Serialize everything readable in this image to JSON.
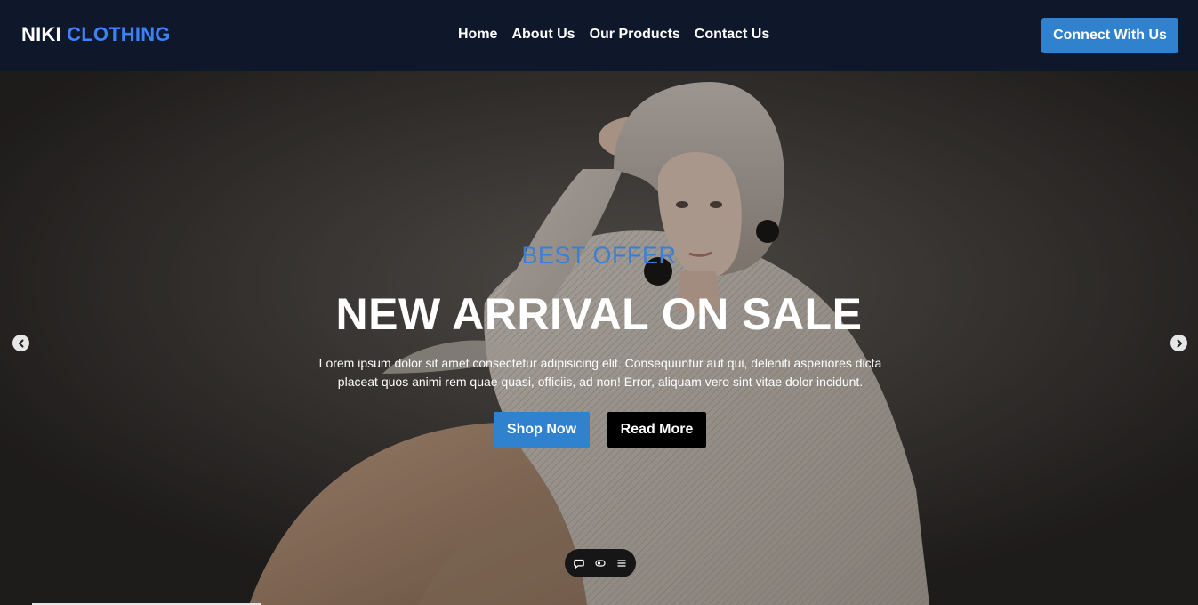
{
  "header": {
    "brand_part1": "NIKI",
    "brand_part2": "CLOTHING",
    "nav": [
      "Home",
      "About Us",
      "Our Products",
      "Contact Us"
    ],
    "cta": "Connect With Us"
  },
  "hero": {
    "kicker": "BEST OFFER",
    "title": "NEW ARRIVAL ON SALE",
    "description": "Lorem ipsum dolor sit amet consectetur adipisicing elit. Consequuntur aut qui, deleniti asperiores dicta placeat quos animi rem quae quasi, officiis, ad non! Error, aliquam vero sint vitae dolor incidunt.",
    "primary_button": "Shop Now",
    "secondary_button": "Read More"
  },
  "carousel": {
    "prev_icon": "chevron-left-icon",
    "next_icon": "chevron-right-icon"
  },
  "toolbar": {
    "icons": [
      "chat-bubble-icon",
      "toggle-icon",
      "menu-icon"
    ]
  },
  "colors": {
    "header_bg": "#0f172a",
    "brand_accent": "#3b82f6",
    "primary_button": "#3182ce",
    "secondary_button": "#000000",
    "kicker": "#3b7fd4"
  }
}
